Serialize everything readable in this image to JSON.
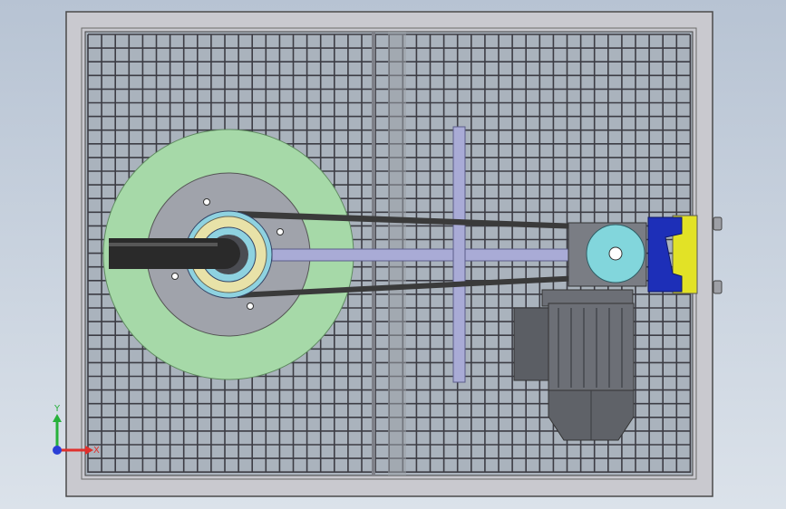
{
  "view": {
    "background_top": "#b7c3d3",
    "background_bottom": "#dbe2ea"
  },
  "colors": {
    "frame": "#c9c9cf",
    "frame_edge": "#4a4a4a",
    "grid_bg": "#aab3bd",
    "grid_line": "#3c3c44",
    "big_disc": "#a6d9a8",
    "inner_disc": "#a0a3ab",
    "hub_outer": "#8ed2e0",
    "hub_ring": "#e8e2a8",
    "shaft": "#2a2a2a",
    "arm": "#a9abd6",
    "belt": "#3a3a3a",
    "small_pulley": "#82d6dc",
    "mount_blue": "#1d2fb8",
    "mount_yellow": "#e2e226",
    "motor": "#6c6f76",
    "motor_dark": "#4e5157"
  },
  "triad": {
    "x_label": "X",
    "y_label": "Y",
    "x_color": "#e0302c",
    "y_color": "#27b13b",
    "z_color": "#2a3fd6"
  }
}
